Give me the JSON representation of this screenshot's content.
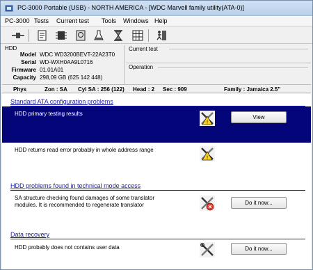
{
  "window": {
    "title": "PC-3000 Portable (USB) - NORTH AMERICA - [WDC Marvell family utility(ATA-0)]"
  },
  "menu": [
    "PC-3000",
    "Tests",
    "Current test",
    "Tools",
    "Windows",
    "Help"
  ],
  "toolbar": {
    "icons": [
      "connect-icon",
      "scroll-icon",
      "chip-icon",
      "hdd-icon",
      "flask-icon",
      "hourglass-icon",
      "grid-icon",
      "exit-icon"
    ]
  },
  "hdd": {
    "group_title": "HDD",
    "model_label": "Model",
    "model": "WDC WD3200BEVT-22A23T0",
    "serial_label": "Serial",
    "serial": "WD-WXH0AA9L0716",
    "firmware_label": "Firmware",
    "firmware": "01.01A01",
    "capacity_label": "Capacity",
    "capacity": "298,09 GB (625 142 448)"
  },
  "current_test": {
    "title": "Current test"
  },
  "operation": {
    "title": "Operation"
  },
  "status": {
    "phys": "Phys",
    "zone": "Zon : SA",
    "cyl": "Cyl SA : 256 (122)",
    "head": "Head : 2",
    "sec": "Sec : 909",
    "family": "Family : Jamaica 2.5\""
  },
  "sections": [
    {
      "title": "Standard ATA configuration problems",
      "items": [
        {
          "text": "HDD primary testing results",
          "button": "View",
          "selected": true
        },
        {
          "text": "HDD returns read error probably in whole address range",
          "button": "",
          "selected": false
        }
      ]
    },
    {
      "title": "HDD problems found in technical mode access",
      "items": [
        {
          "text": "SA structure checking found damages of some translator",
          "text2": "modules. It is recommended to regenerate translator",
          "button": "Do it now...",
          "selected": false
        }
      ]
    },
    {
      "title": "Data recovery",
      "items": [
        {
          "text": "HDD probably does not contains user data",
          "button": "Do it now...",
          "selected": false
        }
      ]
    }
  ]
}
